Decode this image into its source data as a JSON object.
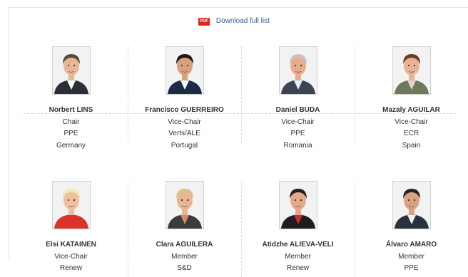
{
  "download": {
    "pdf_label": "PDF",
    "link": "Download full list"
  },
  "members": [
    {
      "name": "Norbert LINS",
      "role": "Chair",
      "group": "PPE",
      "country": "Germany",
      "hair": "#5b4a3a",
      "skin": "#e8b596",
      "suit": "#2a2e36",
      "shirt": "#ffffff",
      "bg": "#f2f2f2"
    },
    {
      "name": "Francisco GUERREIRO",
      "role": "Vice-Chair",
      "group": "Verts/ALE",
      "country": "Portugal",
      "hair": "#1f1712",
      "skin": "#d9a27f",
      "suit": "#1d2b44",
      "shirt": "#f5f7fb",
      "bg": "#f2f2f2"
    },
    {
      "name": "Daniel BUDA",
      "role": "Vice-Chair",
      "group": "PPE",
      "country": "Romania",
      "hair": "#c9c4bc",
      "skin": "#e5ad8e",
      "suit": "#3b4450",
      "shirt": "#e9eef5",
      "bg": "#f2f2f2"
    },
    {
      "name": "Mazaly AGUILAR",
      "role": "Vice-Chair",
      "group": "ECR",
      "country": "Spain",
      "hair": "#6b3a24",
      "skin": "#e7b295",
      "suit": "#6d7a5a",
      "shirt": "#e6d2c8",
      "bg": "#f2f2f2"
    },
    {
      "name": "Elsi KATAINEN",
      "role": "Vice-Chair",
      "group": "Renew",
      "country": "",
      "hair": "#f0e6b6",
      "skin": "#f0bfa0",
      "suit": "#d9342b",
      "shirt": "#d9342b",
      "bg": "#f2f2f2"
    },
    {
      "name": "Clara AGUILERA",
      "role": "Member",
      "group": "S&D",
      "country": "",
      "hair": "#d9c08a",
      "skin": "#e8b596",
      "suit": "#3b3b3b",
      "shirt": "#d98a6a",
      "bg": "#f2f2f2"
    },
    {
      "name": "Atidzhe ALIEVA-VELI",
      "role": "Member",
      "group": "Renew",
      "country": "",
      "hair": "#2b1e18",
      "skin": "#e2aa8b",
      "suit": "#1e1e22",
      "shirt": "#c8302d",
      "bg": "#f2f2f2"
    },
    {
      "name": "Álvaro AMARO",
      "role": "Member",
      "group": "PPE",
      "country": "",
      "hair": "#2a2420",
      "skin": "#d8a283",
      "suit": "#2a3242",
      "shirt": "#f1f1f1",
      "bg": "#f2f2f2"
    }
  ]
}
